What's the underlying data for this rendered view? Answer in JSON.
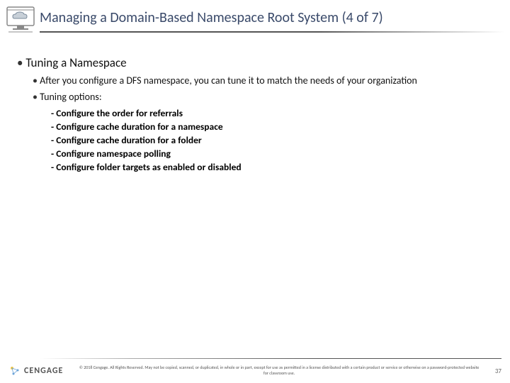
{
  "title": "Managing a Domain-Based Namespace Root System (4 of 7)",
  "heading": "Tuning a Namespace",
  "bullets": {
    "b1": "After you configure a DFS namespace, you can tune it to match the needs of your organization",
    "b2": "Tuning options:"
  },
  "options": {
    "o1": "Configure the order for referrals",
    "o2": "Configure cache duration for a namespace",
    "o3": "Configure cache duration for a folder",
    "o4": "Configure namespace polling",
    "o5": "Configure folder targets as enabled or disabled"
  },
  "footer": {
    "brand": "CENGAGE",
    "copyright": "© 2018 Cengage. All Rights Reserved. May not be copied, scanned, or duplicated, in whole or in part, except for use as permitted in a license distributed with a certain product or service or otherwise on a password-protected website for classroom use.",
    "page": "37"
  }
}
